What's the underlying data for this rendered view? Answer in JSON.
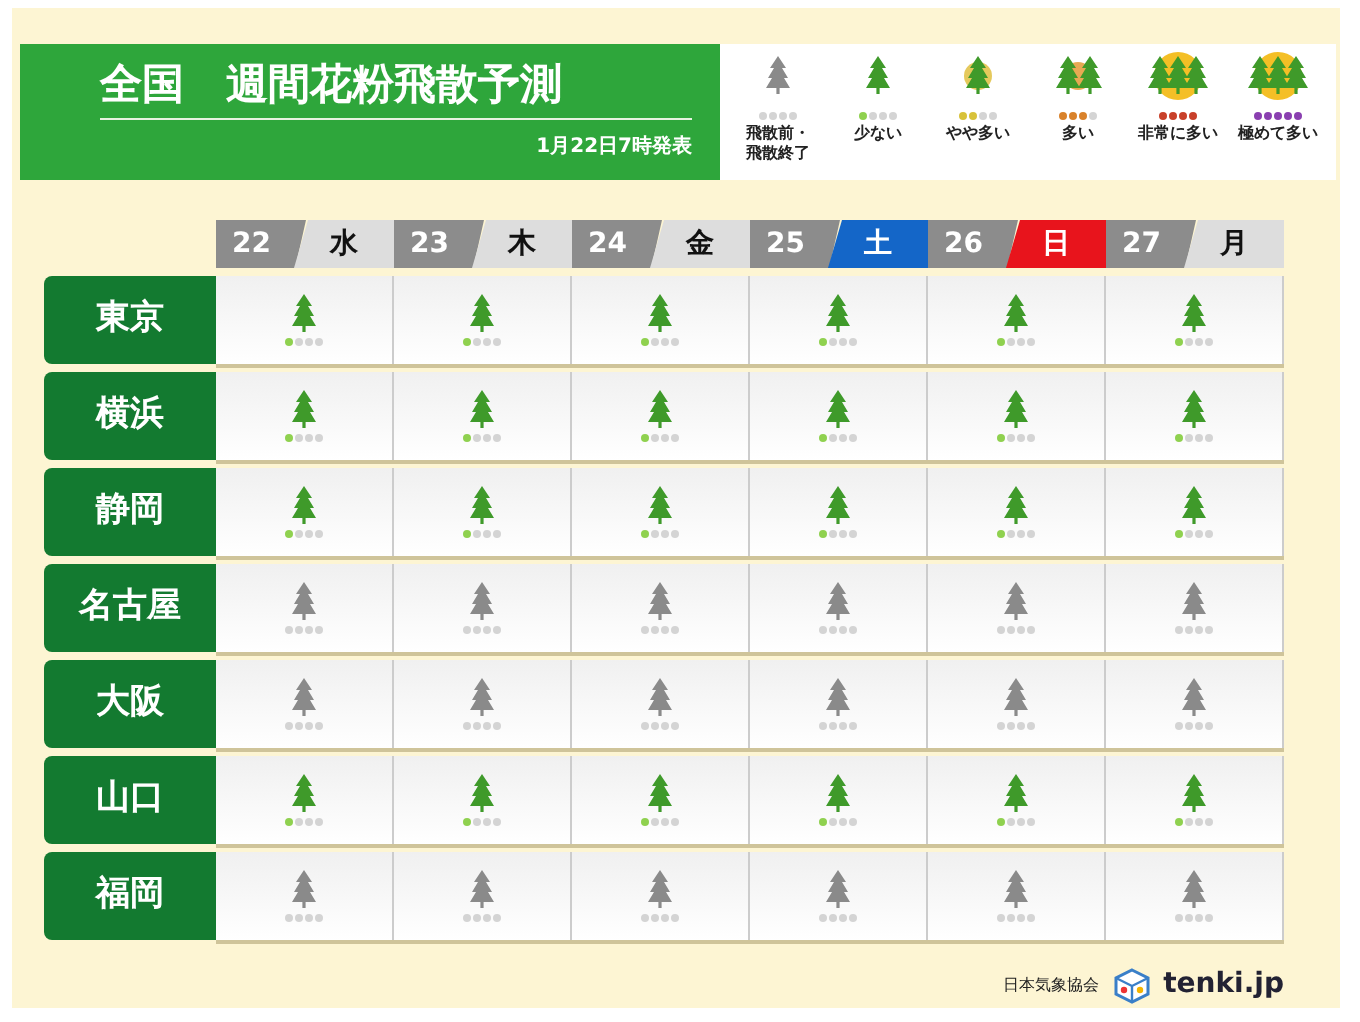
{
  "header": {
    "title": "全国　週間花粉飛散予測",
    "issued": "1月22日7時発表"
  },
  "legend": [
    {
      "label": "飛散前・飛散終了",
      "kind": "none"
    },
    {
      "label": "少ない",
      "kind": "low"
    },
    {
      "label": "やや多い",
      "kind": "moderate"
    },
    {
      "label": "多い",
      "kind": "high"
    },
    {
      "label": "非常に多い",
      "kind": "very_high"
    },
    {
      "label": "極めて多い",
      "kind": "extreme"
    }
  ],
  "days": [
    {
      "date": "22",
      "weekday": "水",
      "kind": "weekday"
    },
    {
      "date": "23",
      "weekday": "木",
      "kind": "weekday"
    },
    {
      "date": "24",
      "weekday": "金",
      "kind": "weekday"
    },
    {
      "date": "25",
      "weekday": "土",
      "kind": "saturday"
    },
    {
      "date": "26",
      "weekday": "日",
      "kind": "sunday"
    },
    {
      "date": "27",
      "weekday": "月",
      "kind": "weekday"
    }
  ],
  "cities": [
    {
      "name": "東京",
      "forecast": [
        {
          "kind": "low"
        },
        {
          "kind": "low"
        },
        {
          "kind": "low"
        },
        {
          "kind": "low"
        },
        {
          "kind": "low"
        },
        {
          "kind": "low"
        }
      ]
    },
    {
      "name": "横浜",
      "forecast": [
        {
          "kind": "low"
        },
        {
          "kind": "low"
        },
        {
          "kind": "low"
        },
        {
          "kind": "low"
        },
        {
          "kind": "low"
        },
        {
          "kind": "low"
        }
      ]
    },
    {
      "name": "静岡",
      "forecast": [
        {
          "kind": "low"
        },
        {
          "kind": "low"
        },
        {
          "kind": "low"
        },
        {
          "kind": "low"
        },
        {
          "kind": "low"
        },
        {
          "kind": "low"
        }
      ]
    },
    {
      "name": "名古屋",
      "forecast": [
        {
          "kind": "none"
        },
        {
          "kind": "none"
        },
        {
          "kind": "none"
        },
        {
          "kind": "none"
        },
        {
          "kind": "none"
        },
        {
          "kind": "none"
        }
      ]
    },
    {
      "name": "大阪",
      "forecast": [
        {
          "kind": "none"
        },
        {
          "kind": "none"
        },
        {
          "kind": "none"
        },
        {
          "kind": "none"
        },
        {
          "kind": "none"
        },
        {
          "kind": "none"
        }
      ]
    },
    {
      "name": "山口",
      "forecast": [
        {
          "kind": "low"
        },
        {
          "kind": "low"
        },
        {
          "kind": "low"
        },
        {
          "kind": "low"
        },
        {
          "kind": "low"
        },
        {
          "kind": "low"
        }
      ]
    },
    {
      "name": "福岡",
      "forecast": [
        {
          "kind": "none"
        },
        {
          "kind": "none"
        },
        {
          "kind": "none"
        },
        {
          "kind": "none"
        },
        {
          "kind": "none"
        },
        {
          "kind": "none"
        }
      ]
    }
  ],
  "footer": {
    "credit": "日本気象協会",
    "brand": "tenki.jp"
  }
}
